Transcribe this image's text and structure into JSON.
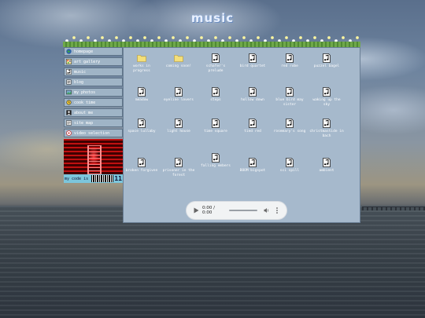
{
  "page": {
    "title": "music"
  },
  "sidebar": {
    "items": [
      {
        "label": "homepage",
        "icon": "globe-icon"
      },
      {
        "label": "art gallery",
        "icon": "palette-icon"
      },
      {
        "label": "music",
        "icon": "music-note-icon"
      },
      {
        "label": "blog",
        "icon": "blog-icon"
      },
      {
        "label": "my photos",
        "icon": "photo-icon"
      },
      {
        "label": "cook time",
        "icon": "cook-icon"
      },
      {
        "label": "about me",
        "icon": "person-icon"
      },
      {
        "label": "site map",
        "icon": "map-icon"
      },
      {
        "label": "video selection",
        "icon": "video-icon"
      }
    ],
    "mycode_label": "my code is",
    "mycode_number": "11"
  },
  "files": [
    {
      "label": "works in progress",
      "type": "folder"
    },
    {
      "label": "coming soon!",
      "type": "folder"
    },
    {
      "label": "schafer's prelude",
      "type": "audio"
    },
    {
      "label": "bird quartet",
      "type": "audio"
    },
    {
      "label": "red robe",
      "type": "audio"
    },
    {
      "label": "puzzel bagel",
      "type": "audio"
    },
    {
      "label": "meadow",
      "type": "audio"
    },
    {
      "label": "eyeline lovers",
      "type": "audio"
    },
    {
      "label": "steps",
      "type": "audio"
    },
    {
      "label": "hollow down",
      "type": "audio"
    },
    {
      "label": "blue bird may sister",
      "type": "audio"
    },
    {
      "label": "waking up the sky",
      "type": "audio"
    },
    {
      "label": "space lullaby",
      "type": "audio"
    },
    {
      "label": "light house",
      "type": "audio"
    },
    {
      "label": "time square",
      "type": "audio"
    },
    {
      "label": "tied red",
      "type": "audio"
    },
    {
      "label": "rosemary's song",
      "type": "audio"
    },
    {
      "label": "christmastide in bach",
      "type": "audio"
    },
    {
      "label": "broken forgiven",
      "type": "audio"
    },
    {
      "label": "prisoner in the forest",
      "type": "audio"
    },
    {
      "label": "falling embers",
      "type": "audio"
    },
    {
      "label": "BOOM bigspot",
      "type": "audio"
    },
    {
      "label": "sci spill",
      "type": "audio"
    },
    {
      "label": "ambient",
      "type": "audio"
    }
  ],
  "player": {
    "time": "0:00 / 0:00",
    "progress": 0
  },
  "colors": {
    "panel": "#a6b9cc",
    "nav": "#9fb4c6",
    "player": "#f1f3f4"
  }
}
